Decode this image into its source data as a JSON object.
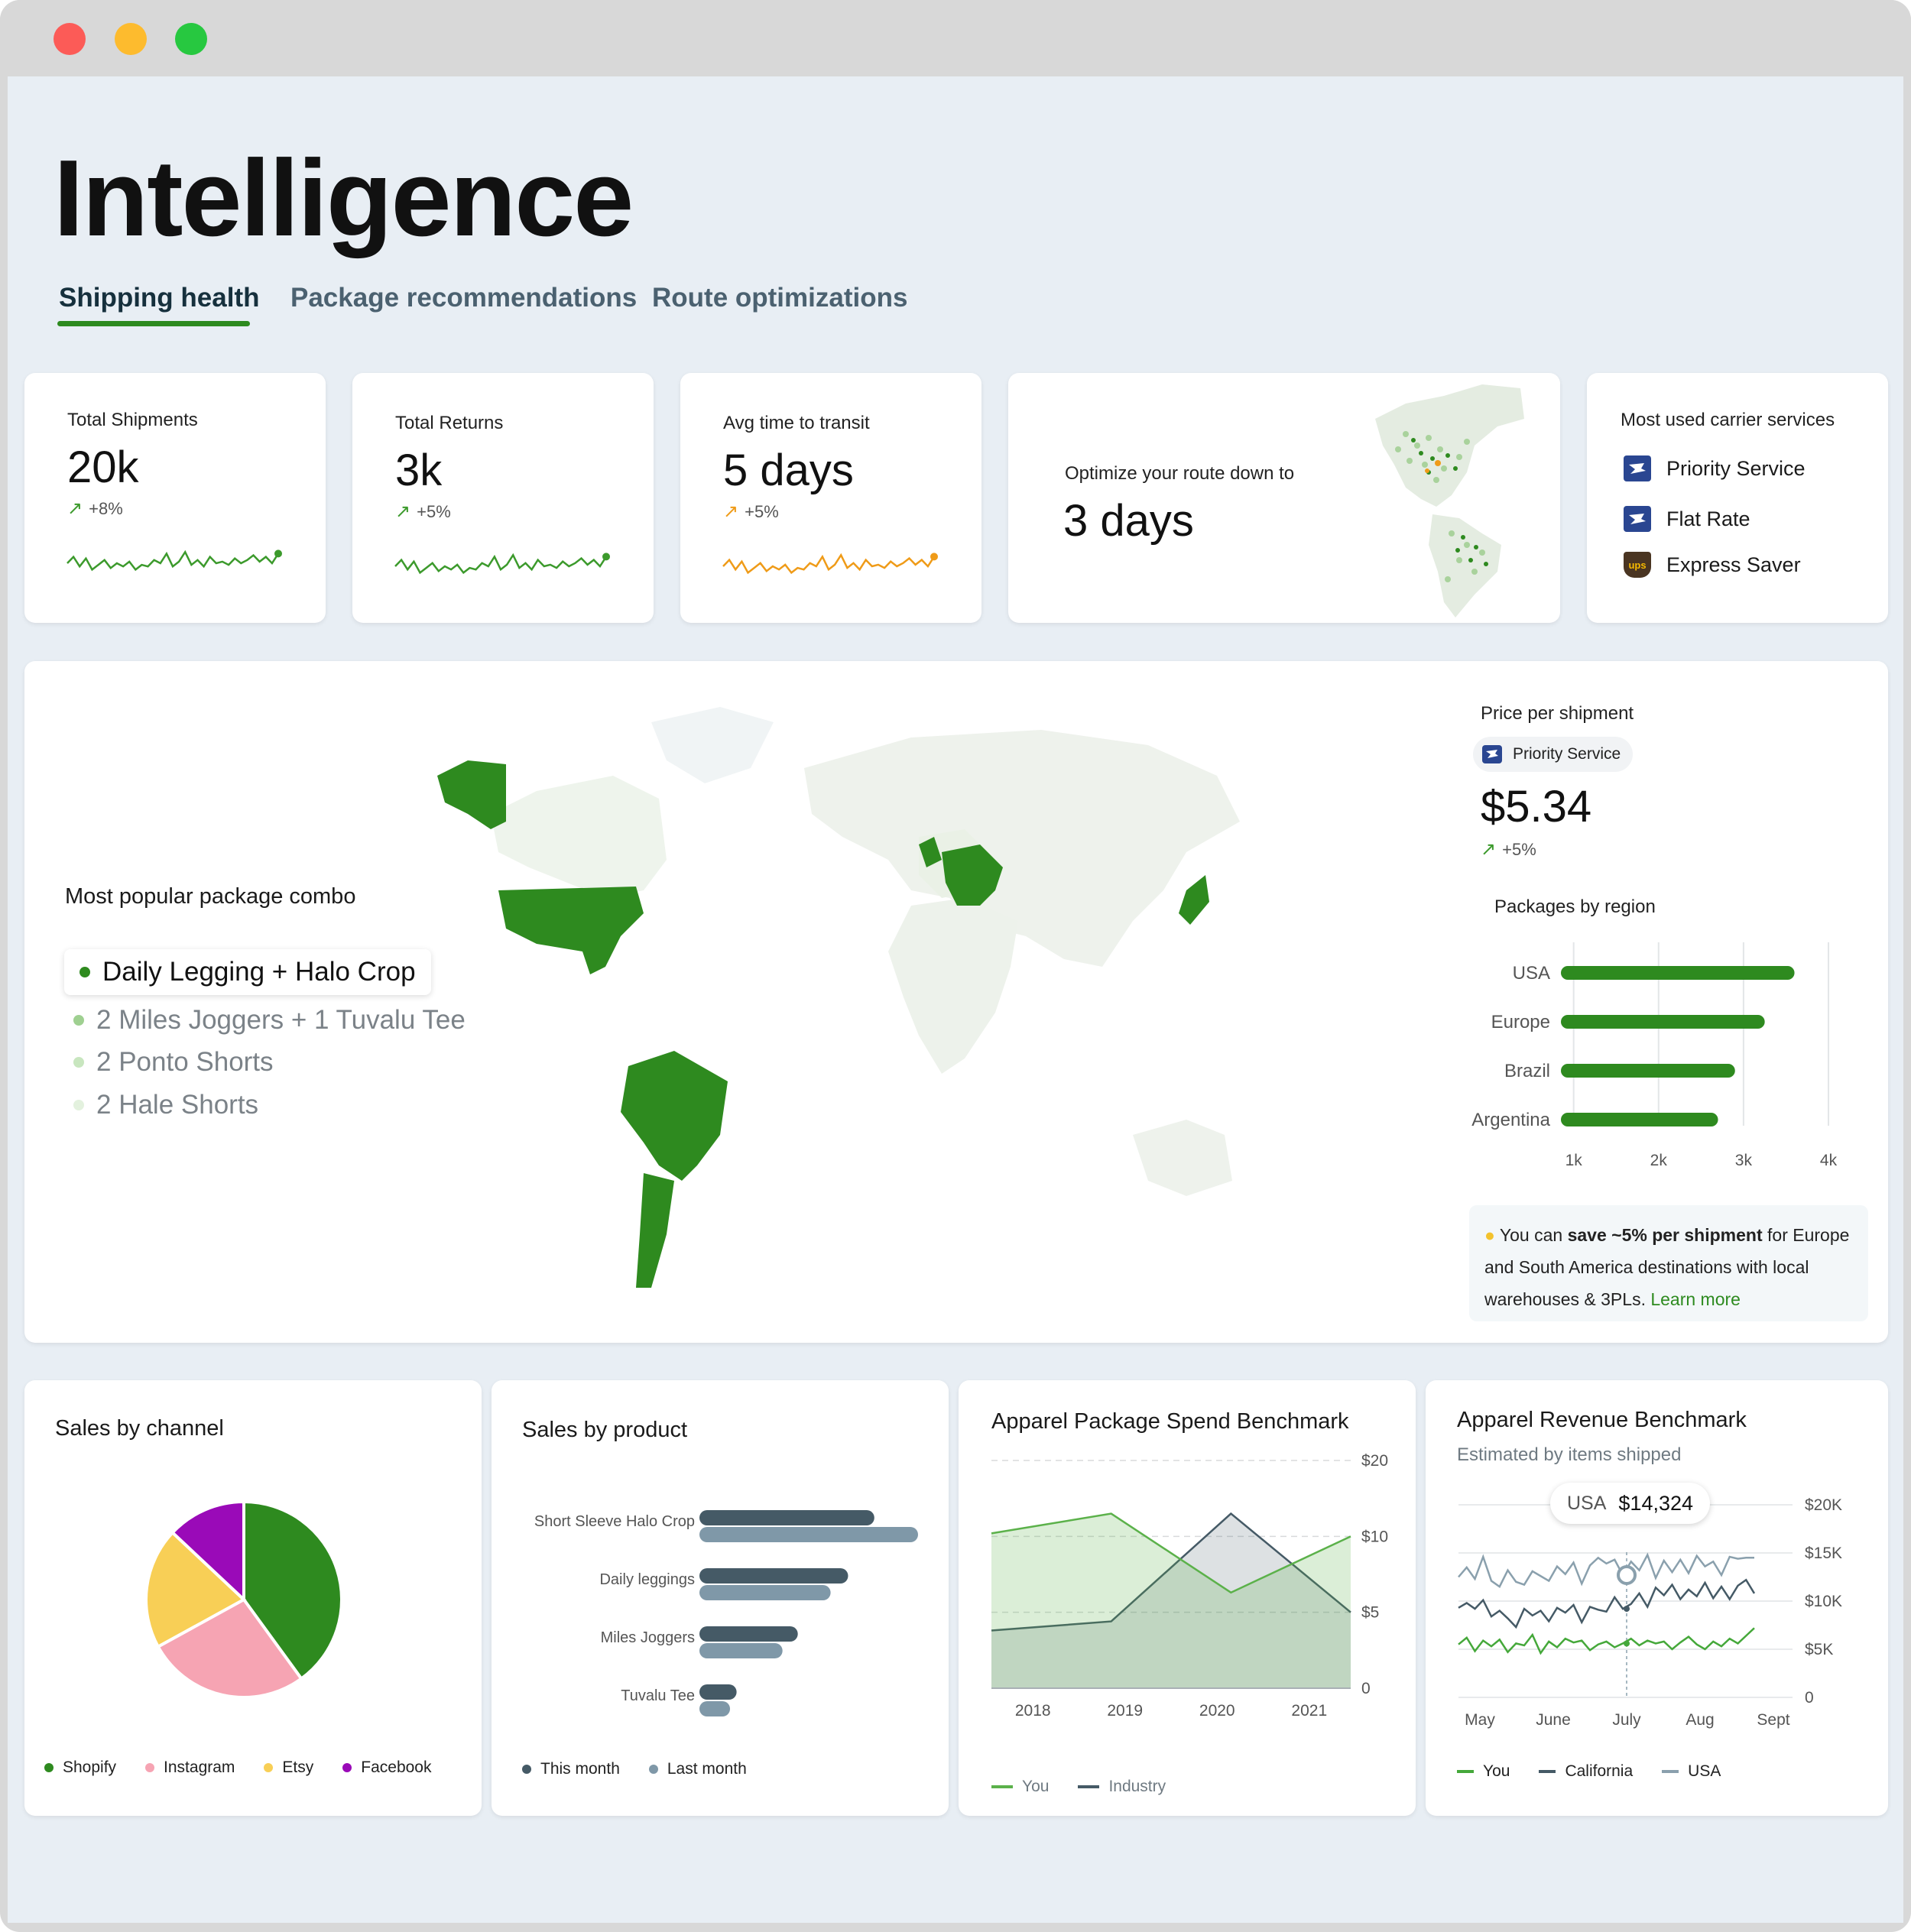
{
  "page": {
    "title": "Intelligence"
  },
  "tabs": [
    {
      "label": "Shipping health",
      "active": true
    },
    {
      "label": "Package recommendations",
      "active": false
    },
    {
      "label": "Route optimizations",
      "active": false
    }
  ],
  "kpis": [
    {
      "label": "Total Shipments",
      "value": "20k",
      "delta": "+8%",
      "color": "#3c9a2c"
    },
    {
      "label": "Total Returns",
      "value": "3k",
      "delta": "+5%",
      "color": "#3c9a2c"
    },
    {
      "label": "Avg time to transit",
      "value": "5 days",
      "delta": "+5%",
      "color": "#ef9b18"
    }
  ],
  "optimize": {
    "label": "Optimize your route down to",
    "value": "3 days"
  },
  "carriers": {
    "title": "Most used carrier services",
    "items": [
      {
        "name": "Priority Service",
        "icon": "usps-eagle-icon"
      },
      {
        "name": "Flat Rate",
        "icon": "usps-eagle-icon"
      },
      {
        "name": "Express Saver",
        "icon": "ups-shield-icon",
        "logo_text": "ups"
      }
    ]
  },
  "combo": {
    "title": "Most popular package combo",
    "primary": "Daily Legging +  Halo Crop",
    "items": [
      "2 Miles Joggers + 1 Tuvalu Tee",
      "2 Ponto Shorts",
      "2 Hale Shorts"
    ]
  },
  "price": {
    "title": "Price per shipment",
    "service": "Priority Service",
    "value": "$5.34",
    "delta": "+5%"
  },
  "regions": {
    "title": "Packages by region",
    "chart_data": {
      "type": "bar",
      "orientation": "horizontal",
      "categories": [
        "USA",
        "Europe",
        "Brazil",
        "Argentina"
      ],
      "values": [
        3.6,
        3.25,
        2.9,
        2.7
      ],
      "ticks": [
        "1k",
        "2k",
        "3k",
        "4k"
      ],
      "xlim": [
        0.85,
        4
      ]
    }
  },
  "tip": {
    "icon": "lightbulb-icon",
    "pre": "You can ",
    "bold": "save ~5% per shipment",
    "post": " for Europe and South America destinations with local warehouses & 3PLs. ",
    "link": "Learn more"
  },
  "sales_channel": {
    "title": "Sales by channel",
    "chart_data": {
      "type": "pie",
      "categories": [
        "Shopify",
        "Instagram",
        "Etsy",
        "Facebook"
      ],
      "values": [
        40,
        27,
        20,
        13
      ],
      "colors": [
        "#2e8a1f",
        "#f6a4b3",
        "#f8cf56",
        "#9a0ab8"
      ]
    }
  },
  "sales_product": {
    "title": "Sales by product",
    "chart_data": {
      "type": "bar",
      "orientation": "horizontal",
      "categories": [
        "Short Sleeve Halo Crop",
        "Daily leggings",
        "Miles Joggers",
        "Tuvalu Tee"
      ],
      "series": [
        {
          "name": "This month",
          "values": [
            80,
            68,
            45,
            17
          ],
          "color": "#455a66"
        },
        {
          "name": "Last month",
          "values": [
            100,
            60,
            38,
            14
          ],
          "color": "#7f98a8"
        }
      ],
      "xlim": [
        0,
        100
      ]
    }
  },
  "spend": {
    "title": "Apparel Package Spend Benchmark",
    "chart_data": {
      "type": "area",
      "x": [
        "2018",
        "2019",
        "2020",
        "2021"
      ],
      "x_values": [
        2017.55,
        2018.85,
        2020.15,
        2021.45
      ],
      "x_ticks": [
        2018,
        2019,
        2020,
        2021
      ],
      "xlim": [
        2017.55,
        2021.45
      ],
      "series": [
        {
          "name": "You",
          "values": [
            10.2,
            11.5,
            6.3,
            10
          ],
          "color": "#5bb14a"
        },
        {
          "name": "Industry",
          "values": [
            3.8,
            4.4,
            11.5,
            5
          ],
          "color": "#455a66"
        }
      ],
      "y_ticks": [
        "0",
        "$5",
        "$10",
        "$20"
      ],
      "ylim": [
        0,
        15
      ]
    }
  },
  "revenue": {
    "title": "Apparel Revenue Benchmark",
    "subtitle": "Estimated by items shipped",
    "tooltip": {
      "region": "USA",
      "value": "$14,324"
    },
    "chart_data": {
      "type": "line",
      "x_ticks": [
        "May",
        "June",
        "July",
        "Aug",
        "Sept"
      ],
      "y_ticks": [
        "0",
        "$5K",
        "$10K",
        "$15K",
        "$20K"
      ],
      "ylim": [
        0,
        20
      ],
      "series": [
        {
          "name": "You",
          "color": "#45a83a",
          "values": [
            5.5,
            6.2,
            4.8,
            5.9,
            5.3,
            6,
            4.7,
            5.6,
            5.4,
            6.5,
            4.6,
            5.8,
            5.2,
            6.1,
            5.7,
            5.9,
            4.9,
            5.5,
            5.8,
            5.2,
            5.6,
            6.1,
            5.4,
            5.9,
            5.6,
            5.8,
            5,
            5.7,
            6.3,
            5.5,
            5,
            5.8,
            5.3,
            6.1,
            5.6,
            6.4,
            7.2
          ]
        },
        {
          "name": "California",
          "color": "#455a66",
          "values": [
            9.3,
            9.8,
            9.2,
            10.1,
            8.4,
            9,
            8.2,
            7.3,
            9.2,
            8.5,
            9,
            7.9,
            9.3,
            8.8,
            9.6,
            7.8,
            9.4,
            9.1,
            8.9,
            10.4,
            9.2,
            9.7,
            10.8,
            9.4,
            11.4,
            10.6,
            11.7,
            10.2,
            11.2,
            10.5,
            11.9,
            10.3,
            11.5,
            10.2,
            11.6,
            12.2,
            10.8
          ]
        },
        {
          "name": "USA",
          "color": "#8aa0ad",
          "values": [
            12.5,
            13.5,
            12.3,
            14.6,
            12.1,
            11.5,
            13.2,
            12,
            11.7,
            13.1,
            12.6,
            12.1,
            13.6,
            12.8,
            14,
            11.8,
            13.7,
            14.5,
            13.9,
            14.3,
            12.7,
            14.1,
            13.2,
            14.8,
            12.4,
            14.2,
            13,
            14.3,
            12.9,
            14.7,
            13.6,
            14.1,
            12.7,
            14.6,
            14.4,
            14.5,
            14.5
          ]
        }
      ]
    }
  }
}
